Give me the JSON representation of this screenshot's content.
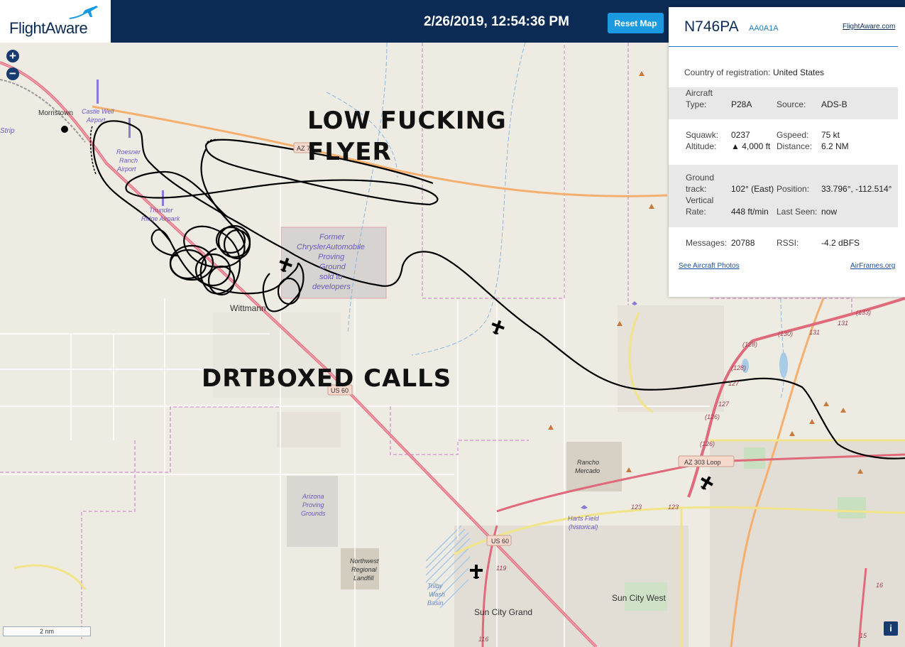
{
  "header": {
    "logo_text": "FlightAware",
    "datetime": "2/26/2019, 12:54:36 PM",
    "reset_label": "Reset Map"
  },
  "map_controls": {
    "zoom_in": "+",
    "zoom_out": "−",
    "scale": "2 nm",
    "info": "i"
  },
  "overlay": {
    "line1": "LOW FUCKING",
    "line2": "FLYER",
    "line3": "DRTBOXED CALLS"
  },
  "map_labels": {
    "morristown": "Morristown",
    "castle_well": "Castle Well",
    "castle_well2": "Airport",
    "strip": "Strip",
    "roesner1": "Roesner",
    "roesner2": "Ranch",
    "roesner3": "Airport",
    "thunder1": "Thunder",
    "thunder2": "Ridge Airpark",
    "az74": "AZ 74",
    "former1": "Former",
    "former2": "ChryslerAutomobile",
    "former3": "Proving",
    "former4": "Ground",
    "former5": "sold to",
    "former6": "developers",
    "wittmann": "Wittmann",
    "us60a": "US 60",
    "us60b": "US 60",
    "rancho1": "Rancho",
    "rancho2": "Mercado",
    "azpg1": "Arizona",
    "azpg2": "Proving",
    "azpg3": "Grounds",
    "nw1": "Northwest",
    "nw2": "Regional",
    "nw3": "Landfill",
    "harts1": "Harts Field",
    "harts2": "(historical)",
    "trilby1": "Trilby",
    "trilby2": "Wash",
    "trilby3": "Basin",
    "suncitygrand": "Sun City Grand",
    "suncitywest": "Sun City West",
    "az303": "AZ 303 Loop",
    "r133": "(133)",
    "r130": "(130)",
    "r131": "131",
    "r131b": "131",
    "r128a": "(128)",
    "r128b": "(128)",
    "r127a": "127",
    "r127b": "127",
    "r126a": "(126)",
    "r126b": "(126)",
    "r123a": "123",
    "r123b": "123",
    "r119": "119",
    "r116": "116",
    "r16": "16",
    "r15": "15"
  },
  "panel": {
    "tail": "N746PA",
    "hex": "AA0A1A",
    "fa_link": "FlightAware.com",
    "country_label": "Country of registration:",
    "country_value": "United States",
    "aircraft_type_label": "Aircraft Type:",
    "aircraft_type_label1": "Aircraft",
    "aircraft_type_label2": "Type:",
    "aircraft_type": "P28A",
    "source_label": "Source:",
    "source": "ADS-B",
    "squawk_label": "Squawk:",
    "squawk": "0237",
    "gspeed_label": "Gspeed:",
    "gspeed": "75 kt",
    "altitude_label": "Altitude:",
    "altitude": "▲ 4,000 ft",
    "distance_label": "Distance:",
    "distance": "6.2 NM",
    "ground_label1": "Ground",
    "ground_label2": "track:",
    "ground_track": "102° (East)",
    "position_label": "Position:",
    "position": "33.796°, -112.514°",
    "vrate_label1": "Vertical",
    "vrate_label2": "Rate:",
    "vrate": "448 ft/min",
    "lastseen_label": "Last Seen:",
    "lastseen": "now",
    "messages_label": "Messages:",
    "messages": "20788",
    "rssi_label": "RSSI:",
    "rssi": "-4.2 dBFS",
    "photos_link": "See Aircraft Photos",
    "airframes_link": "AirFrames.org"
  },
  "colors": {
    "header_bg": "#0b2b54",
    "button": "#1a9ae0",
    "highway": "#e07080",
    "primary_road": "#f5c08a",
    "track": "#000000"
  }
}
